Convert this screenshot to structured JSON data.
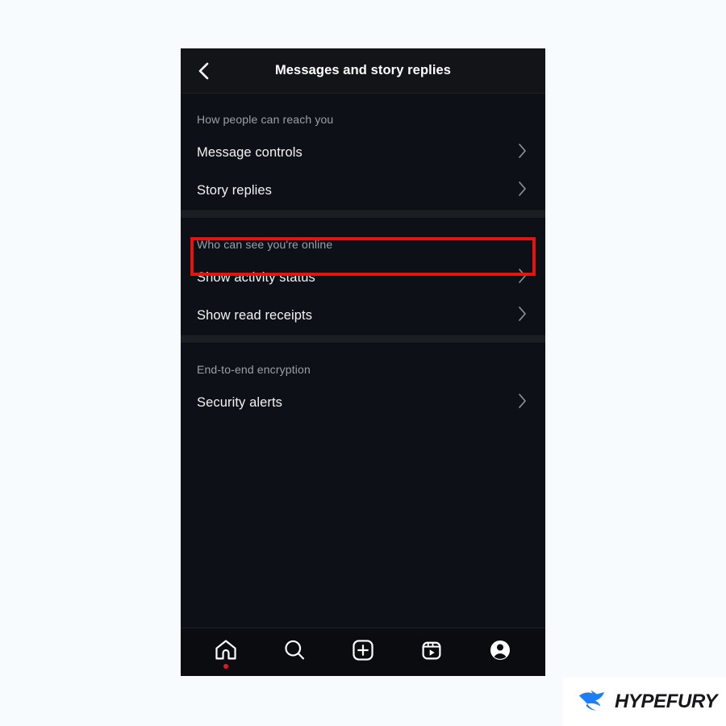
{
  "page": {
    "background_color": "#f8fbfd"
  },
  "phone": {
    "background_color": "#0d1117",
    "header": {
      "title": "Messages and story replies",
      "back_icon": "chevron-left-icon"
    },
    "sections": [
      {
        "title": "How people can reach you",
        "rows": [
          {
            "label": "Message controls",
            "chevron": "chevron-right-icon",
            "highlighted": false
          },
          {
            "label": "Story replies",
            "chevron": "chevron-right-icon",
            "highlighted": true
          }
        ]
      },
      {
        "title": "Who can see you're online",
        "rows": [
          {
            "label": "Show activity status",
            "chevron": "chevron-right-icon",
            "highlighted": false
          },
          {
            "label": "Show read receipts",
            "chevron": "chevron-right-icon",
            "highlighted": false
          }
        ]
      },
      {
        "title": "End-to-end encryption",
        "rows": [
          {
            "label": "Security alerts",
            "chevron": "chevron-right-icon",
            "highlighted": false
          }
        ]
      }
    ],
    "highlight": {
      "color": "#e8130f",
      "target_row": "Story replies"
    },
    "navbar": {
      "items": [
        {
          "name": "home",
          "icon": "home-icon",
          "badge": true,
          "badge_color": "#e8142b"
        },
        {
          "name": "search",
          "icon": "search-icon",
          "badge": false
        },
        {
          "name": "create",
          "icon": "plus-square-icon",
          "badge": false
        },
        {
          "name": "reels",
          "icon": "reels-icon",
          "badge": false
        },
        {
          "name": "profile",
          "icon": "profile-avatar-icon",
          "badge": false
        }
      ]
    }
  },
  "watermark": {
    "text": "HYPEFURY",
    "icon": "hypefury-bird-icon",
    "icon_color": "#1d7efd",
    "text_color": "#18181a",
    "background_color": "#ffffff"
  }
}
